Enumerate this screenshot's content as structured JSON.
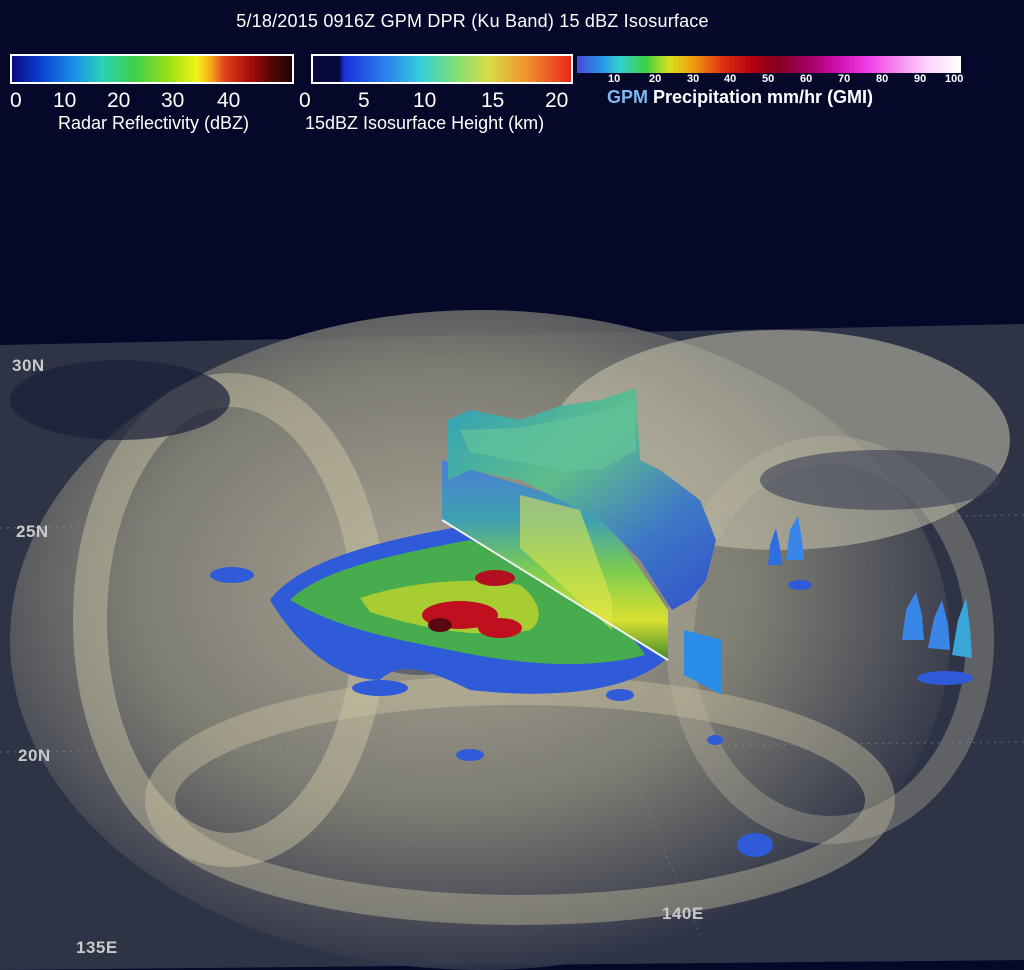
{
  "header": {
    "title": "5/18/2015 0916Z GPM DPR (Ku Band) 15 dBZ Isosurface"
  },
  "legends": {
    "reflectivity": {
      "label": "Radar Reflectivity (dBZ)",
      "ticks": [
        "0",
        "10",
        "20",
        "30",
        "40"
      ],
      "range": [
        0,
        50
      ]
    },
    "isosurface_height": {
      "label": "15dBZ Isosurface Height (km)",
      "ticks": [
        "0",
        "5",
        "10",
        "15",
        "20"
      ],
      "range": [
        0,
        21
      ]
    },
    "precipitation": {
      "label_prefix": "GPM",
      "label_rest": "Precipitation mm/hr (GMI)",
      "ticks": [
        "10",
        "20",
        "30",
        "40",
        "50",
        "60",
        "70",
        "80",
        "90",
        "100"
      ],
      "range": [
        0,
        100
      ]
    }
  },
  "map": {
    "lat_labels": [
      "30N",
      "25N",
      "20N"
    ],
    "lon_labels": [
      "135E",
      "140E"
    ]
  },
  "colors": {
    "background": "#06082a",
    "low_precip": "#2b49d6",
    "mid_precip": "#49b53f",
    "high_precip": "#c01020",
    "cloud": "#c9c4ad"
  }
}
